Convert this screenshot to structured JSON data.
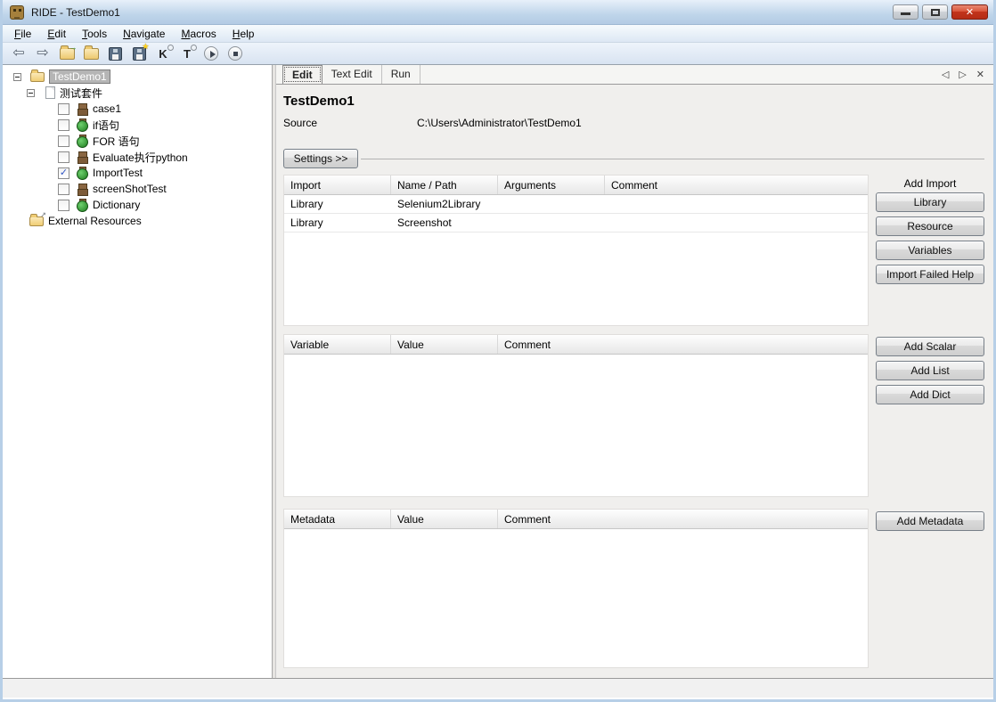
{
  "window": {
    "title": "RIDE - TestDemo1",
    "controls": {
      "minimize": "minimize",
      "maximize": "maximize",
      "close": "close"
    }
  },
  "menu": {
    "items": [
      {
        "mnemonic": "F",
        "rest": "ile"
      },
      {
        "mnemonic": "E",
        "rest": "dit"
      },
      {
        "mnemonic": "T",
        "rest": "ools"
      },
      {
        "mnemonic": "N",
        "rest": "avigate"
      },
      {
        "mnemonic": "M",
        "rest": "acros"
      },
      {
        "mnemonic": "H",
        "rest": "elp"
      }
    ]
  },
  "toolbar": {
    "icons": [
      {
        "name": "go-back-icon",
        "glyph": "⇦"
      },
      {
        "name": "go-forward-icon",
        "glyph": "⇨"
      },
      {
        "name": "open-test-suite-icon",
        "glyph": "→"
      },
      {
        "name": "open-directory-icon",
        "glyph": ""
      },
      {
        "name": "save-icon",
        "glyph": ""
      },
      {
        "name": "save-all-icon",
        "glyph": "★"
      },
      {
        "name": "search-keywords-icon",
        "glyph": "K"
      },
      {
        "name": "search-tests-icon",
        "glyph": "T"
      },
      {
        "name": "run-tests-icon",
        "glyph": ""
      },
      {
        "name": "stop-running-icon",
        "glyph": ""
      }
    ]
  },
  "tree": {
    "root": {
      "label": "TestDemo1"
    },
    "suite": {
      "label": "测试套件"
    },
    "items": [
      {
        "label": "case1",
        "checked": false,
        "icon": "robot-brown"
      },
      {
        "label": "if语句",
        "checked": false,
        "icon": "robot-green"
      },
      {
        "label": "FOR 语句",
        "checked": false,
        "icon": "robot-green"
      },
      {
        "label": "Evaluate执行python",
        "checked": false,
        "icon": "robot-brown"
      },
      {
        "label": "ImportTest",
        "checked": true,
        "icon": "robot-green"
      },
      {
        "label": "screenShotTest",
        "checked": false,
        "icon": "robot-brown"
      },
      {
        "label": "Dictionary",
        "checked": false,
        "icon": "robot-green"
      }
    ],
    "external": {
      "label": "External Resources"
    }
  },
  "tabs": {
    "items": [
      {
        "label": "Edit",
        "active": true
      },
      {
        "label": "Text Edit",
        "active": false
      },
      {
        "label": "Run",
        "active": false
      }
    ],
    "nav": {
      "prev": "◁",
      "next": "▷",
      "close": "✕"
    }
  },
  "details": {
    "title": "TestDemo1",
    "source_label": "Source",
    "source_value": "C:\\Users\\Administrator\\TestDemo1",
    "settings_button": "Settings >>"
  },
  "import_table": {
    "columns": [
      "Import",
      "Name / Path",
      "Arguments",
      "Comment"
    ],
    "rows": [
      [
        "Library",
        "Selenium2Library",
        "",
        ""
      ],
      [
        "Library",
        "Screenshot",
        "",
        ""
      ]
    ]
  },
  "import_actions": {
    "label": "Add Import",
    "buttons": [
      "Library",
      "Resource",
      "Variables",
      "Import Failed Help"
    ]
  },
  "variable_table": {
    "columns": [
      "Variable",
      "Value",
      "Comment"
    ]
  },
  "variable_actions": {
    "buttons": [
      "Add Scalar",
      "Add List",
      "Add Dict"
    ]
  },
  "metadata_table": {
    "columns": [
      "Metadata",
      "Value",
      "Comment"
    ]
  },
  "metadata_actions": {
    "buttons": [
      "Add Metadata"
    ]
  },
  "icons": {
    "check_glyph": "✓"
  },
  "colors": {
    "titlebar_blue": "#bfd5ea",
    "close_red": "#c3351c",
    "robot_green": "#2f9e2f",
    "robot_brown": "#7d5b38",
    "selection_gray": "#b5b5b5",
    "window_border": "#b7cfe7"
  }
}
